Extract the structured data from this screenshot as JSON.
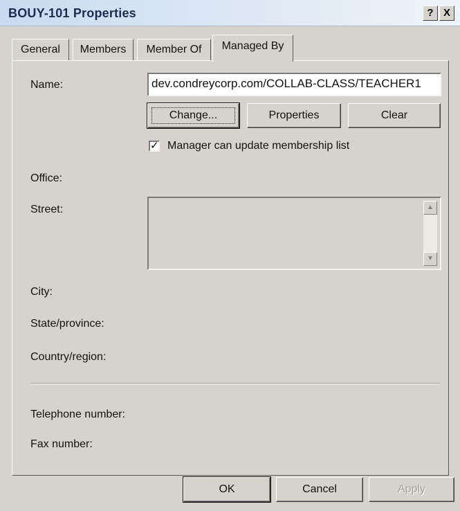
{
  "window": {
    "title": "BOUY-101 Properties",
    "help_label": "?",
    "close_label": "X"
  },
  "tabs": [
    {
      "label": "General"
    },
    {
      "label": "Members"
    },
    {
      "label": "Member Of"
    },
    {
      "label": "Managed By"
    }
  ],
  "active_tab": "Managed By",
  "managed_by": {
    "name_label": "Name:",
    "name_value": "dev.condreycorp.com/COLLAB-CLASS/TEACHER1",
    "change_label": "Change...",
    "properties_label": "Properties",
    "clear_label": "Clear",
    "manager_update_label": "Manager can update membership list",
    "manager_update_checked": true,
    "office_label": "Office:",
    "street_label": "Street:",
    "street_value": "",
    "city_label": "City:",
    "state_label": "State/province:",
    "country_label": "Country/region:",
    "telephone_label": "Telephone number:",
    "fax_label": "Fax number:"
  },
  "footer": {
    "ok_label": "OK",
    "cancel_label": "Cancel",
    "apply_label": "Apply"
  }
}
